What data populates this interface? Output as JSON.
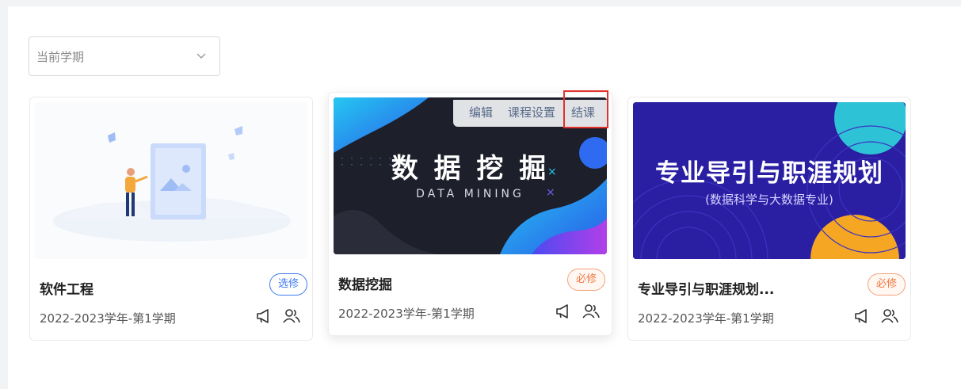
{
  "filter": {
    "semester_value": "当前学期"
  },
  "cards": [
    {
      "title": "软件工程",
      "badge": "选修",
      "term": "2022-2023学年-第1学期"
    },
    {
      "title": "数据挖掘",
      "badge": "必修",
      "term": "2022-2023学年-第1学期",
      "cover_title": "数 据 挖 掘",
      "cover_subtitle": "DATA MINING",
      "hover_menu": [
        "编辑",
        "课程设置",
        "结课"
      ]
    },
    {
      "title": "专业导引与职涯规划...",
      "badge": "必修",
      "term": "2022-2023学年-第1学期",
      "cover_title": "专业导引与职涯规划",
      "cover_subtitle": "(数据科学与大数据专业)"
    }
  ],
  "colors": {
    "elective": "#3f7af0",
    "required": "#f07840",
    "highlight": "#e0332c"
  },
  "icons": [
    "chevron-down-icon",
    "megaphone-icon",
    "users-icon"
  ]
}
